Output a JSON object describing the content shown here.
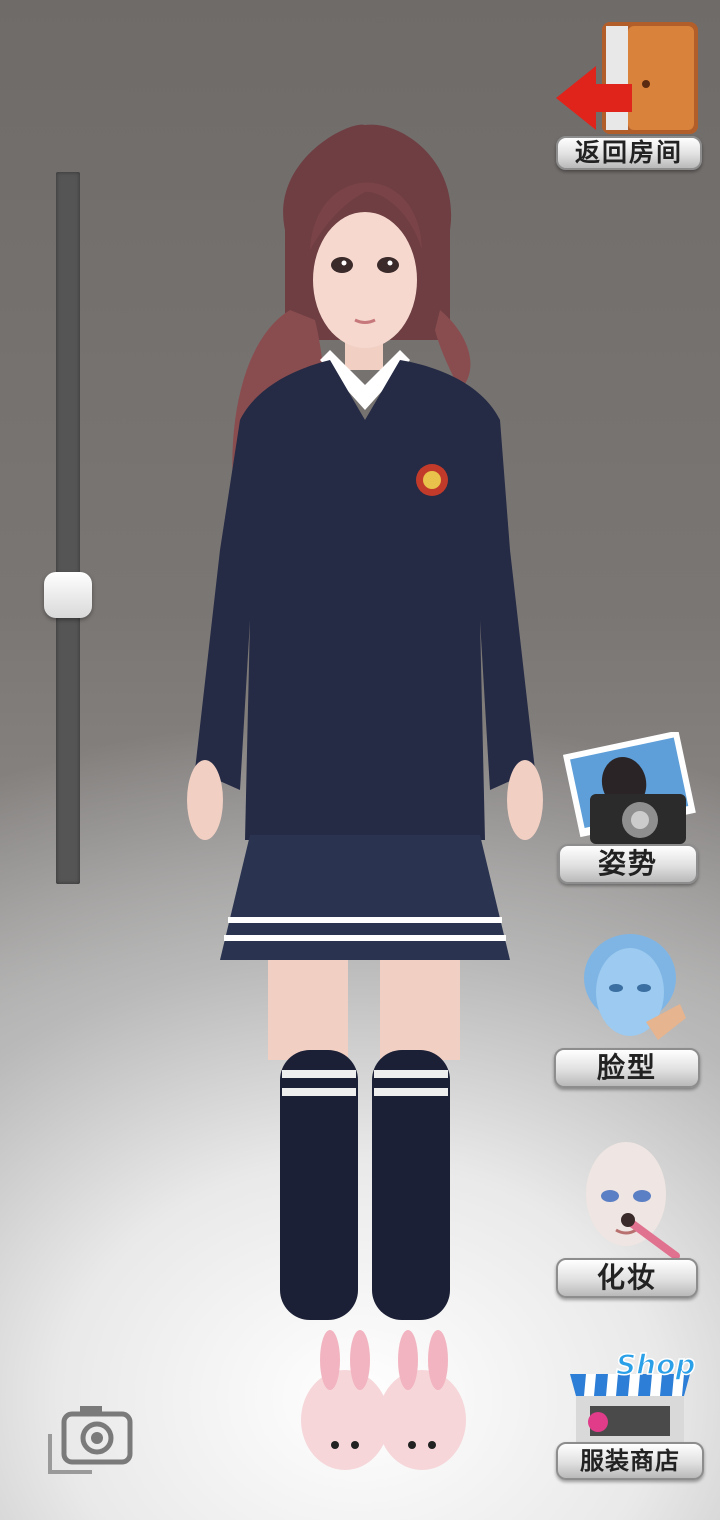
{
  "return_button": {
    "label": "返回房间",
    "icon": "door-exit-icon"
  },
  "zoom_slider": {
    "level": 0.4
  },
  "side_buttons": [
    {
      "key": "pose",
      "label": "姿势",
      "icon": "camera-photo-icon"
    },
    {
      "key": "face",
      "label": "脸型",
      "icon": "face-shape-icon"
    },
    {
      "key": "makeup",
      "label": "化妆",
      "icon": "makeup-brush-icon"
    },
    {
      "key": "shop",
      "label": "服装商店",
      "icon": "shop-icon",
      "icon_text": "Shop"
    }
  ],
  "screenshot_button": {
    "icon": "camera-icon"
  },
  "colors": {
    "sweater": "#252a45",
    "hair": "#8a4d4f",
    "background": "#7a7674"
  }
}
